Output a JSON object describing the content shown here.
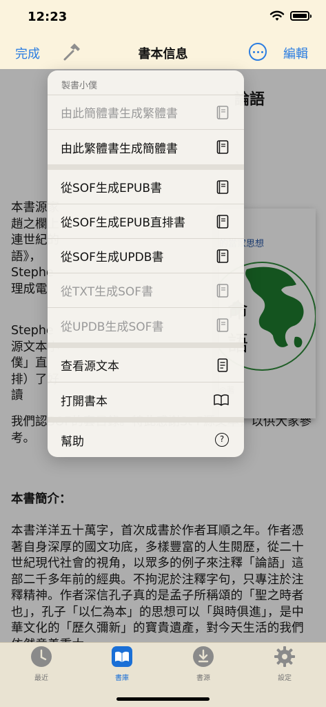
{
  "status": {
    "time": "12:23"
  },
  "nav": {
    "done": "完成",
    "title": "書本信息",
    "edit": "編輯"
  },
  "content": {
    "book_title": "論語",
    "para1": "本書源家趙之欄上連世紀的語》，Stephe理成電",
    "para2": "Stephe源文本小僕」直排）了好讀",
    "para3": "我們認SOF的套目錄。特此感謝St F源文本，以供大家參考。",
    "section_heading": "本書簡介：",
    "intro": "本書洋洋五十萬字，首次成書於作者耳順之年。作者憑著自身深厚的國文功底，多樣豐富的人生閱歷，從二十世紀現代社會的視角，以眾多的例子來注釋「論語」這部二千多年前的經典。不拘泥於注釋字句，只專注於注釋精神。作者深信孔子真的是孟子所稱頌的「聖之時者也」，孔子「以仁為本」的思想可以「與時俱進」，是中華文化的「歷久彌新」的寶貴遺產，對今天生活的我們依然意義重大。"
  },
  "cover": {
    "heading": "的當家思想",
    "glyph1": "命",
    "glyph2": "語",
    "author": "◎著"
  },
  "menu": {
    "header": "製書小僕",
    "items": [
      {
        "label": "由此簡體書生成繁體書",
        "icon": "book-icon",
        "disabled": true
      },
      {
        "label": "由此繁體書生成簡體書",
        "icon": "book-icon",
        "disabled": false
      },
      {
        "label": "從SOF生成EPUB書",
        "icon": "book-icon",
        "disabled": false
      },
      {
        "label": "從SOF生成EPUB直排書",
        "icon": "book-icon",
        "disabled": false
      },
      {
        "label": "從SOF生成UPDB書",
        "icon": "book-icon",
        "disabled": false
      },
      {
        "label": "從TXT生成SOF書",
        "icon": "book-icon",
        "disabled": true
      },
      {
        "label": "從UPDB生成SOF書",
        "icon": "book-icon",
        "disabled": true
      },
      {
        "label": "查看源文本",
        "icon": "document-icon",
        "disabled": false
      },
      {
        "label": "打開書本",
        "icon": "open-book-icon",
        "disabled": false
      },
      {
        "label": "幫助",
        "icon": "question-circle-icon",
        "disabled": false
      }
    ]
  },
  "tabs": [
    {
      "label": "最近",
      "icon": "clock-icon",
      "active": false
    },
    {
      "label": "書庫",
      "icon": "library-book-icon",
      "active": true
    },
    {
      "label": "書源",
      "icon": "download-icon",
      "active": false
    },
    {
      "label": "設定",
      "icon": "gear-icon",
      "active": false
    }
  ],
  "colors": {
    "accent": "#2b7de1",
    "background": "#fbf3dd",
    "tab_bar": "#e9e3d2",
    "active_tab": "#1a6fd6"
  }
}
